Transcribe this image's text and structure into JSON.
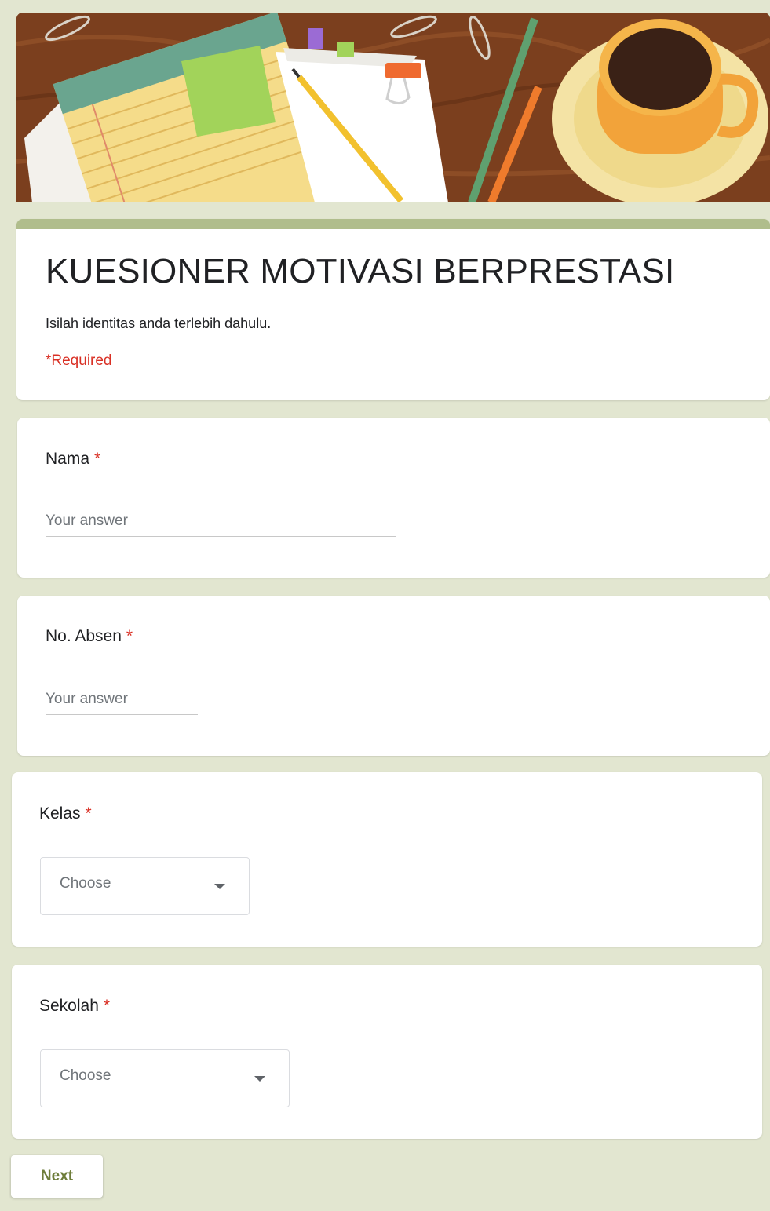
{
  "banner": {
    "image": "desk-illustration-with-notepad-pencils-coffee-cup"
  },
  "form": {
    "title": "KUESIONER MOTIVASI BERPRESTASI",
    "description": "Isilah identitas anda terlebih dahulu.",
    "required_note": "*Required"
  },
  "questions": [
    {
      "label": "Nama",
      "required_mark": "*",
      "type": "text",
      "placeholder": "Your answer",
      "value": ""
    },
    {
      "label": "No. Absen",
      "required_mark": "*",
      "type": "text",
      "placeholder": "Your answer",
      "value": ""
    },
    {
      "label": "Kelas",
      "required_mark": "*",
      "type": "dropdown",
      "selected": "Choose"
    },
    {
      "label": "Sekolah",
      "required_mark": "*",
      "type": "dropdown",
      "selected": "Choose"
    }
  ],
  "footer": {
    "next_label": "Next"
  },
  "colors": {
    "page_background": "#e2e6d0",
    "accent": "#b0bd8c",
    "required": "#d93025",
    "button_text": "#6e7d3a"
  }
}
